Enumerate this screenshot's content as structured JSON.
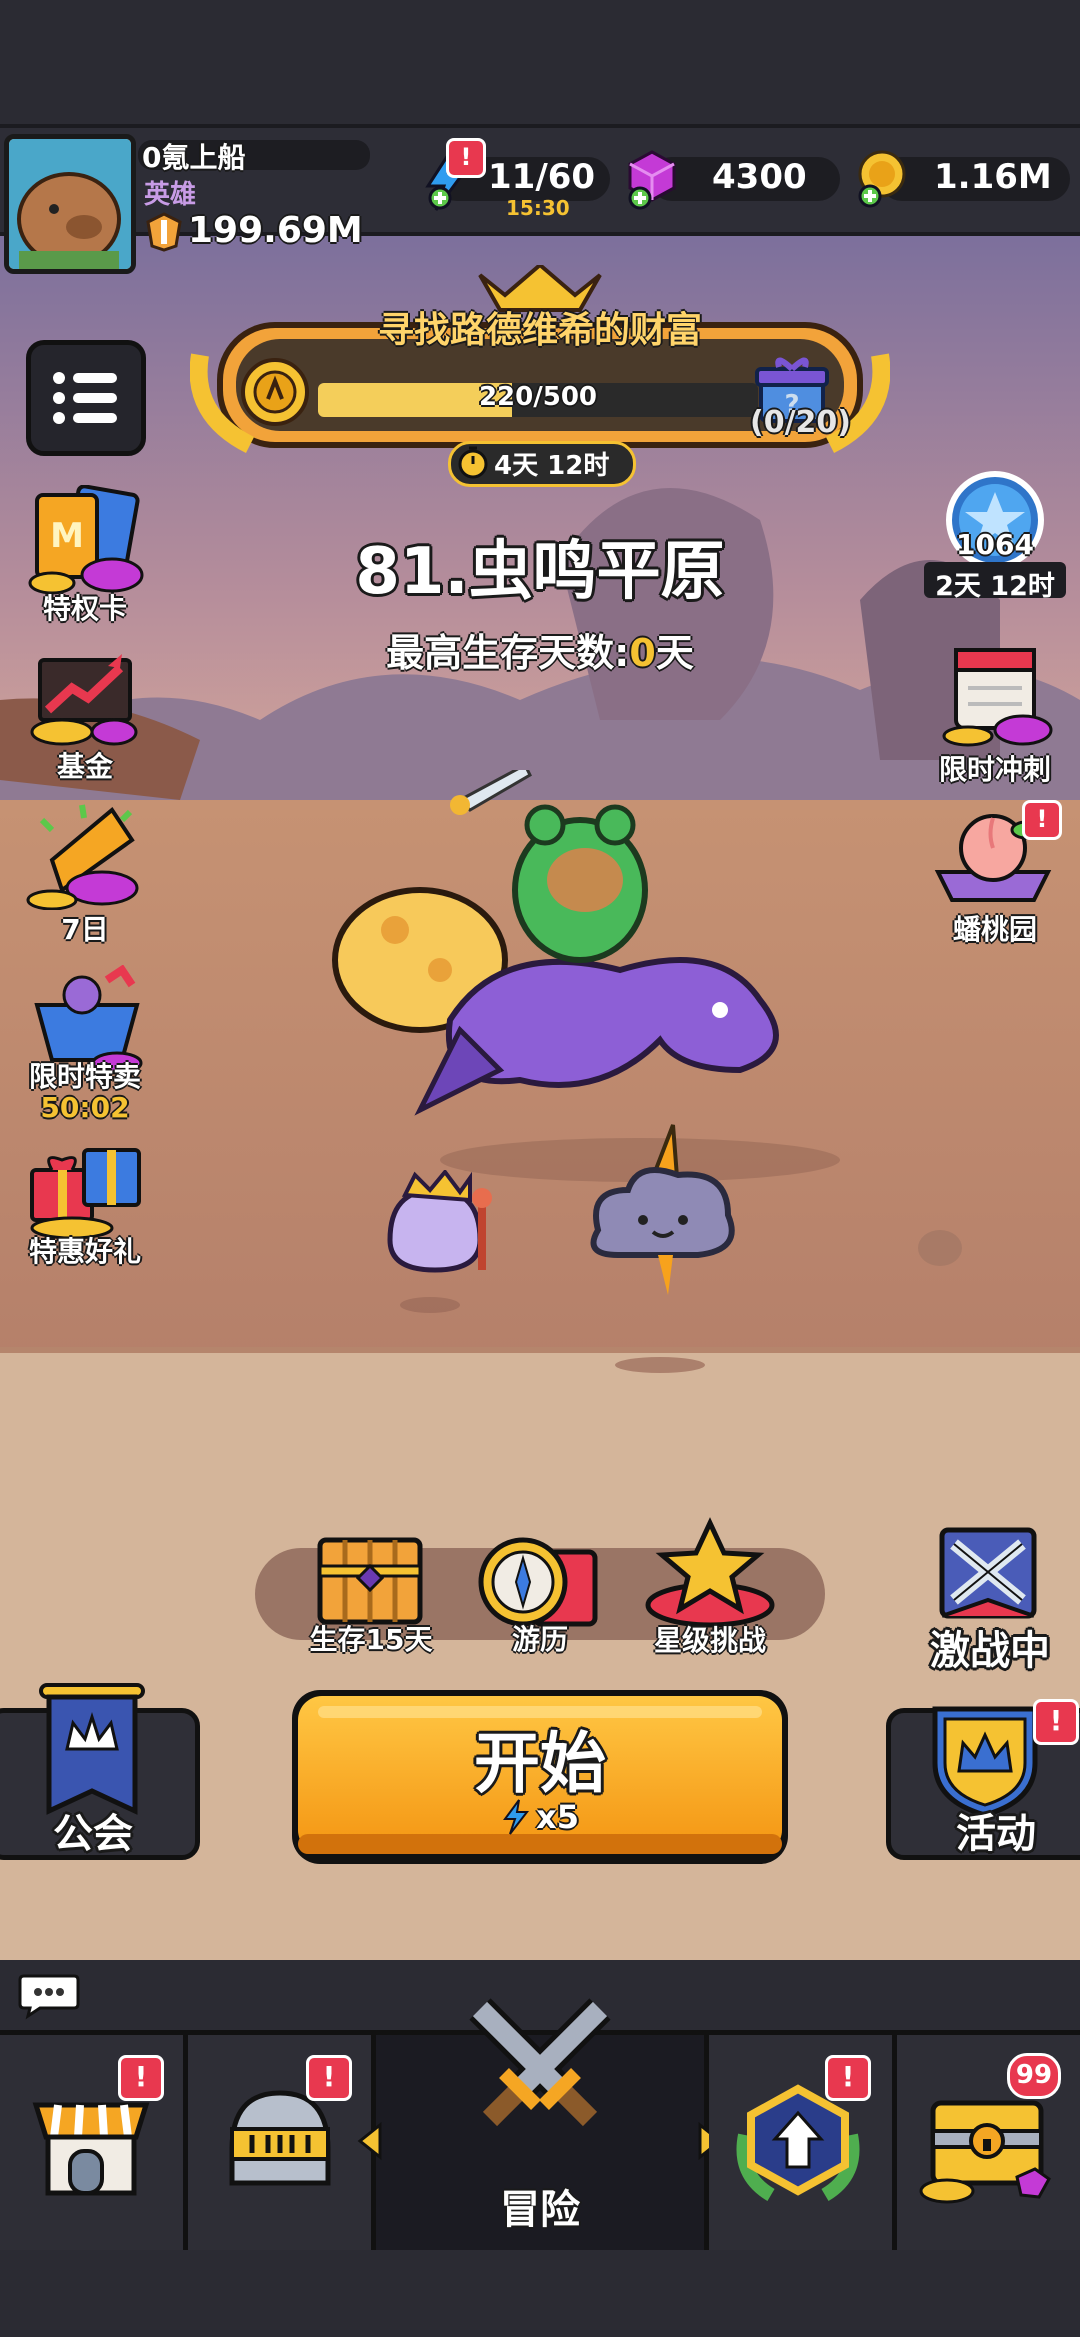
{
  "player": {
    "name": "0氪上船",
    "title": "英雄",
    "power": "199.69M"
  },
  "resources": {
    "energy": "11/60",
    "energy_timer": "15:30",
    "gems": "4300",
    "coins": "1.16M"
  },
  "event": {
    "title": "寻找路德维希的财富",
    "progress_text": "220/500",
    "progress": 0.44,
    "chest_count": "(0/20)",
    "time_left": "4天 12时"
  },
  "stage": {
    "title": "81.虫鸣平原",
    "subtitle_prefix": "最高生存天数:",
    "subtitle_value": "0",
    "subtitle_suffix": "天"
  },
  "left_menu": [
    {
      "label": "特权卡"
    },
    {
      "label": "基金"
    },
    {
      "label": "7日"
    },
    {
      "label": "限时特卖",
      "timer": "50:02"
    },
    {
      "label": "特惠好礼"
    }
  ],
  "right_menu": {
    "star_count": "1064",
    "star_timer": "2天 12时",
    "sprint": "限时冲刺",
    "peach": "蟠桃园"
  },
  "modes": {
    "survive": "生存15天",
    "travel": "游历",
    "star": "星级挑战",
    "battle": "激战中"
  },
  "actions": {
    "guild": "公会",
    "start": "开始",
    "start_cost": "x5",
    "activity": "活动"
  },
  "nav": {
    "adventure": "冒险",
    "chest_badge": "99",
    "alert_mark": "!"
  },
  "colors": {
    "accent_orange": "#f7a21c",
    "alert_red": "#e8384f",
    "gem_purple": "#c43ad6",
    "energy_blue": "#2f9cf0",
    "coin_gold": "#f5c232"
  }
}
